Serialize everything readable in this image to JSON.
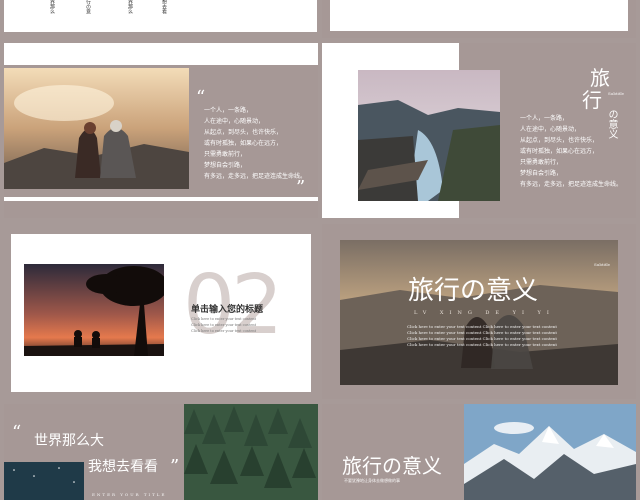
{
  "palette": {
    "background": "#a79a98",
    "panel_taupe": "#a69896",
    "white": "#ffffff"
  },
  "slide1": {
    "labels": [
      "世界那么大",
      "旅行の意义",
      "世界那么大",
      "我想去看看"
    ]
  },
  "slide3": {
    "body": [
      "一个人，一条路，",
      "人在途中，心随景动，",
      "从起点，到尽头，也许快乐，",
      "或有时孤独，如果心在远方，",
      "只需勇敢前行，",
      "梦想自会引路，",
      "有多远，走多远，把足迹连成生命线。"
    ]
  },
  "slide4": {
    "title_chars": [
      "旅",
      "行"
    ],
    "title_vertical": "の意义",
    "small_tag": "Subtitle",
    "body": [
      "一个人，一条路，",
      "人在途中，心随景动，",
      "从起点，到尽头，也许快乐，",
      "或有时孤独，如果心在远方，",
      "只需勇敢前行，",
      "梦想自会引路，",
      "有多远，走多远，把足迹连成生命线。"
    ]
  },
  "slide5": {
    "number": "02",
    "heading": "单击输入您的标题",
    "lines": [
      "Click here to enter your text content",
      "Click here to enter your text content",
      "Click here to enter your text content"
    ]
  },
  "slide6": {
    "title": "旅行の意义",
    "subtitle": "LV XING DE YI YI",
    "tag": "Subtitle",
    "lines": [
      "Click here to enter your text content Click here to enter your text content",
      "Click here to enter your text content Click here to enter your text content",
      "Click here to enter your text content Click here to enter your text content",
      "Click here to enter your text content Click here to enter your text content"
    ]
  },
  "slide7": {
    "line1": "世界那么大",
    "line2": "我想去看看",
    "footer": "ENTER YOUR TITLE"
  },
  "slide8": {
    "title": "旅行の意义",
    "caption": "不要犹豫地让身体去做想做的事"
  }
}
